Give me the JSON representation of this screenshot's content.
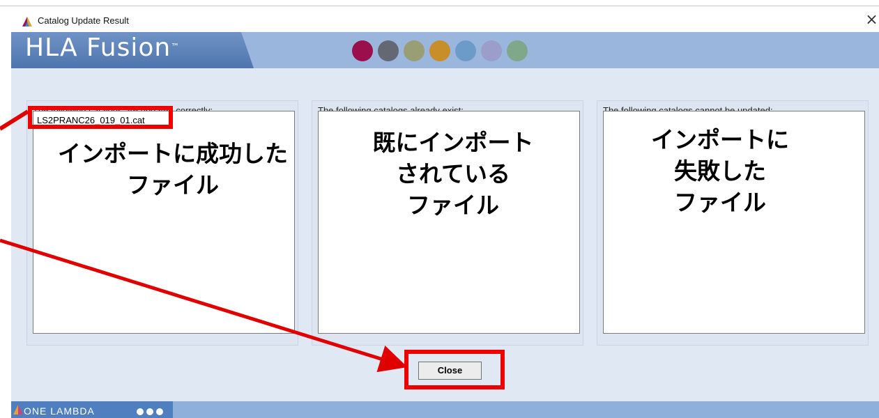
{
  "window": {
    "title": "Catalog Update Result",
    "close_glyph": "×",
    "icon": "one-lambda-app-icon"
  },
  "banner": {
    "logo_text": "HLA Fusion",
    "logo_tm": "™",
    "dot_colors": [
      "#9a0f4c",
      "#646872",
      "#9a9e74",
      "#c78e2a",
      "#6d9bc9",
      "#9a9ec9",
      "#7fa88a"
    ],
    "background": "#9ab6dc"
  },
  "panels": [
    {
      "label": "The following catalogs are updated correctly:",
      "items": [
        "LS2PRANC26_019_01.cat"
      ],
      "annotation": [
        "インポートに成功した",
        "ファイル"
      ]
    },
    {
      "label": "The following catalogs already exist:",
      "items": [],
      "annotation": [
        "既にインポート",
        "されている",
        "ファイル"
      ]
    },
    {
      "label": "The following catalogs cannot be updated:",
      "items": [],
      "annotation": [
        "インポートに",
        "失敗した",
        "ファイル"
      ]
    }
  ],
  "buttons": {
    "close_label": "Close"
  },
  "footer": {
    "brand": "ONE LAMBDA",
    "icon": "one-lambda-logo-icon"
  },
  "colors": {
    "highlight": "#ee0000",
    "window_bg": "#dfe8f3"
  }
}
